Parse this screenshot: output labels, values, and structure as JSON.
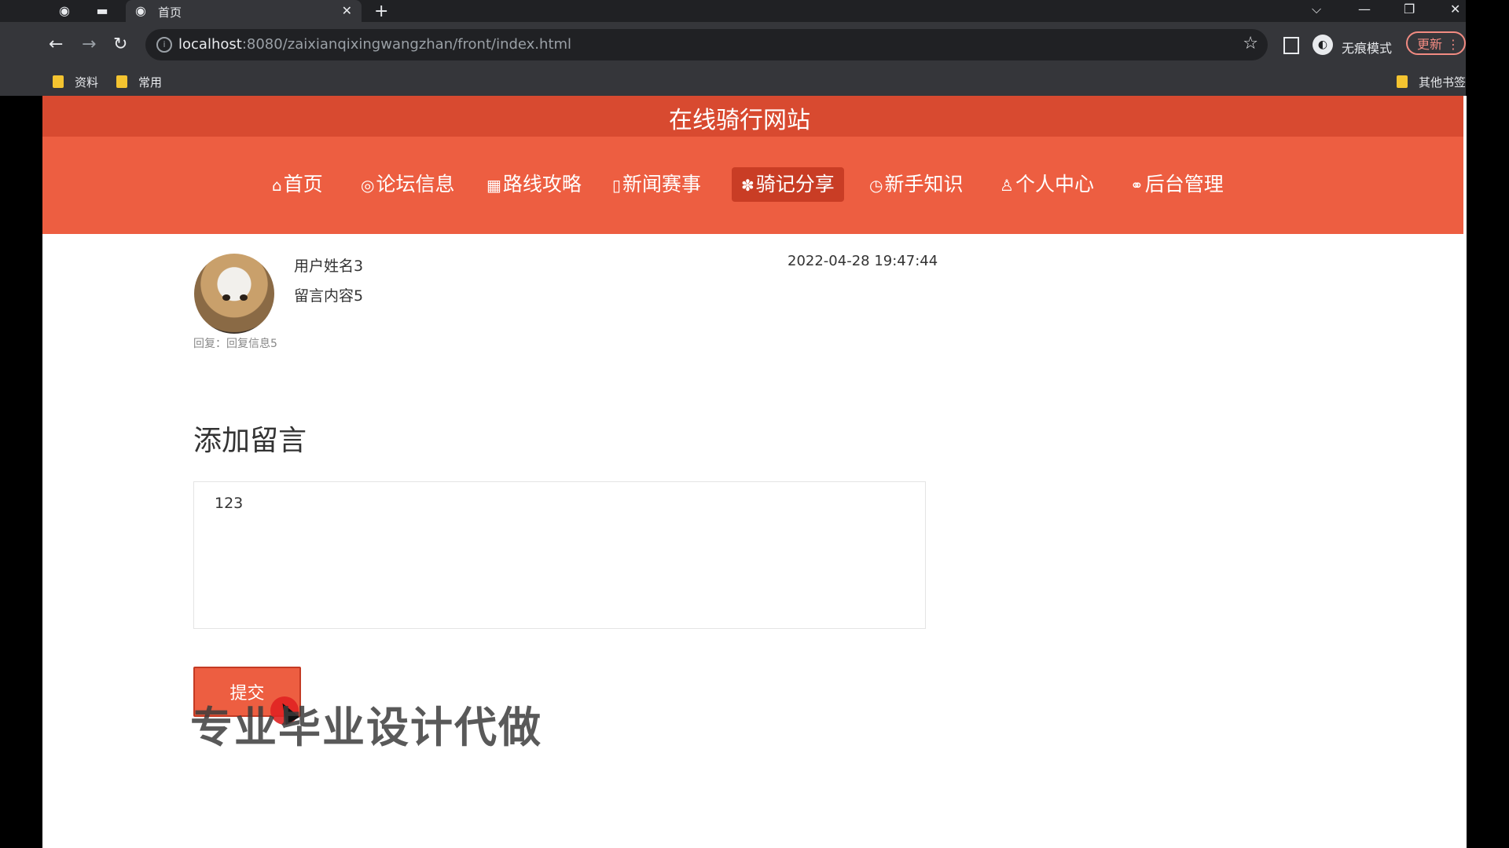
{
  "browser": {
    "tab_title": "首页",
    "tab_close": "✕",
    "new_tab": "+",
    "url_host": "localhost",
    "url_path": ":8080/zaixianqixingwangzhan/front/index.html",
    "incognito_label": "无痕模式",
    "update_label": "更新",
    "bookmarks": [
      "资料",
      "常用"
    ],
    "other_bookmarks": "其他书签"
  },
  "site": {
    "title": "在线骑行网站",
    "nav": [
      {
        "icon": "⌂",
        "label": "首页"
      },
      {
        "icon": "◎",
        "label": "论坛信息"
      },
      {
        "icon": "▦",
        "label": "路线攻略"
      },
      {
        "icon": "▯",
        "label": "新闻赛事"
      },
      {
        "icon": "✽",
        "label": "骑记分享"
      },
      {
        "icon": "◷",
        "label": "新手知识"
      },
      {
        "icon": "♙",
        "label": "个人中心"
      },
      {
        "icon": "⚭",
        "label": "后台管理"
      }
    ],
    "active_nav": "骑记分享"
  },
  "comment": {
    "username": "用户姓名3",
    "content": "留言内容5",
    "datetime": "2022-04-28 19:47:44",
    "reply": "回复：回复信息5"
  },
  "form": {
    "title": "添加留言",
    "textarea_value": "123",
    "submit_label": "提交"
  },
  "overlay": {
    "watermark": "专业毕业设计代做"
  }
}
